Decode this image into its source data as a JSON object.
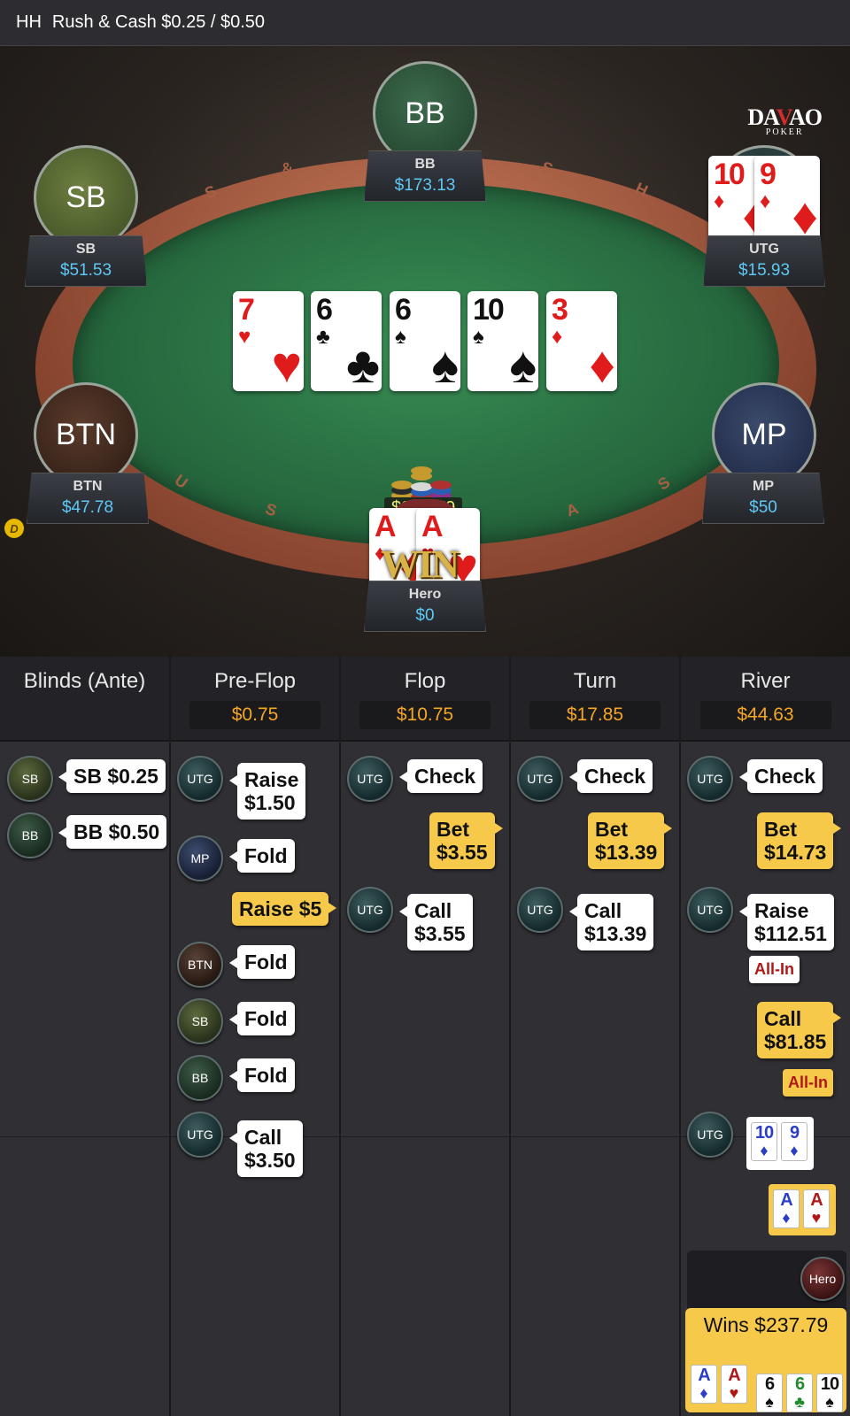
{
  "header": {
    "prefix": "HH",
    "title": "Rush & Cash $0.25 / $0.50"
  },
  "logo": {
    "text_a": "DA",
    "text_v": "V",
    "text_b": "AO",
    "sub": "POKER"
  },
  "rail_letters": [
    "R",
    "U",
    "S",
    "H",
    "&",
    "C",
    "A",
    "S",
    "H"
  ],
  "seats": {
    "bb": {
      "label": "BB",
      "name": "BB",
      "stack": "$173.13"
    },
    "sb": {
      "label": "SB",
      "name": "SB",
      "stack": "$51.53"
    },
    "utg": {
      "name": "UTG",
      "stack": "$15.93"
    },
    "btn": {
      "label": "BTN",
      "name": "BTN",
      "stack": "$47.78"
    },
    "mp": {
      "label": "MP",
      "name": "MP",
      "stack": "$50"
    },
    "hero": {
      "name": "Hero",
      "stack": "$0"
    }
  },
  "board": [
    {
      "rank": "7",
      "suit": "♥",
      "color": "red"
    },
    {
      "rank": "6",
      "suit": "♣",
      "color": "black"
    },
    {
      "rank": "6",
      "suit": "♠",
      "color": "black"
    },
    {
      "rank": "10",
      "suit": "♠",
      "color": "black"
    },
    {
      "rank": "3",
      "suit": "♦",
      "color": "red"
    }
  ],
  "utg_cards": [
    {
      "rank": "10",
      "suit": "♦"
    },
    {
      "rank": "9",
      "suit": "♦"
    }
  ],
  "hero_cards": [
    {
      "rank": "A",
      "suit": "♦"
    },
    {
      "rank": "A",
      "suit": "♥"
    }
  ],
  "win_label": "WIN",
  "dealer_label": "D",
  "pot": "$237.79",
  "history": {
    "columns": [
      {
        "title": "Blinds (Ante)",
        "pot": ""
      },
      {
        "title": "Pre-Flop",
        "pot": "$0.75"
      },
      {
        "title": "Flop",
        "pot": "$10.75"
      },
      {
        "title": "Turn",
        "pot": "$17.85"
      },
      {
        "title": "River",
        "pot": "$44.63"
      }
    ],
    "blinds": [
      {
        "chip": "SB",
        "action": "SB $0.25"
      },
      {
        "chip": "BB",
        "action": "BB $0.50"
      }
    ],
    "preflop": {
      "utg_raise": "Raise\n$1.50",
      "mp_fold": "Fold",
      "hero_raise": "Raise $5",
      "btn_fold": "Fold",
      "sb_fold": "Fold",
      "bb_fold": "Fold",
      "utg_call": "Call\n$3.50"
    },
    "flop": {
      "utg_check": "Check",
      "hero_bet": "Bet\n$3.55",
      "utg_call": "Call\n$3.55"
    },
    "turn": {
      "utg_check": "Check",
      "hero_bet": "Bet\n$13.39",
      "utg_call": "Call\n$13.39"
    },
    "river": {
      "utg_check": "Check",
      "hero_bet": "Bet\n$14.73",
      "utg_raise": "Raise\n$112.51",
      "utg_allin": "All-In",
      "hero_call": "Call\n$81.85",
      "hero_allin": "All-In",
      "utg_show": [
        {
          "rank": "10",
          "suit": "♦"
        },
        {
          "rank": "9",
          "suit": "♦"
        }
      ],
      "hero_show": [
        {
          "rank": "A",
          "suit": "♦"
        },
        {
          "rank": "A",
          "suit": "♥"
        }
      ]
    },
    "winner": {
      "chip": "Hero",
      "text": "Wins $237.79",
      "hand": [
        {
          "rank": "A",
          "suit": "♦",
          "color": "blue"
        },
        {
          "rank": "A",
          "suit": "♥",
          "color": "red"
        },
        {
          "rank": "6",
          "suit": "♠",
          "color": "black"
        },
        {
          "rank": "6",
          "suit": "♣",
          "color": "green"
        },
        {
          "rank": "10",
          "suit": "♠",
          "color": "black"
        }
      ]
    },
    "chip_labels": {
      "utg": "UTG",
      "mp": "MP",
      "btn": "BTN",
      "sb": "SB",
      "bb": "BB"
    }
  }
}
